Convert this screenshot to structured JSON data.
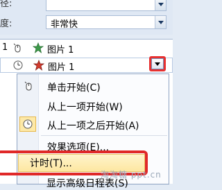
{
  "properties": {
    "row1_label_cut": "径:",
    "row2_label_cut": "度:",
    "speed_value": "非常快"
  },
  "animation_list": {
    "row1": {
      "number": "1",
      "name": "图片 1"
    },
    "row2": {
      "name": "图片 1"
    }
  },
  "context_menu": {
    "items": [
      {
        "label": "单击开始(C)",
        "icon": "mouse-click-icon"
      },
      {
        "label": "从上一项开始(W)",
        "icon": ""
      },
      {
        "label": "从上一项之后开始(A)",
        "icon": "clock-icon",
        "checked": true
      },
      {
        "label": "效果选项(E)...",
        "icon": ""
      },
      {
        "label": "计时(T)...",
        "icon": "",
        "highlighted": true
      },
      {
        "label": "显示高级日程表(S)",
        "icon": ""
      }
    ]
  },
  "watermark": "淘淘糖 ppt.cn",
  "colors": {
    "highlight_red": "#e02828",
    "menu_highlight": "#fde7a1"
  }
}
